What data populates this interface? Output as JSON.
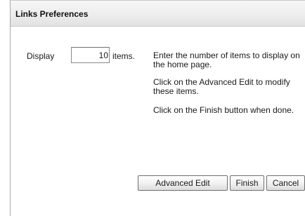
{
  "panel": {
    "title": "Links Preferences"
  },
  "form": {
    "display_label": "Display",
    "count_value": "10",
    "items_label": "items."
  },
  "instructions": [
    "Enter the number of items to display on the home page.",
    "Click on the Advanced Edit to modify these items.",
    "Click on the Finish button when done."
  ],
  "buttons": {
    "advanced_edit": "Advanced Edit",
    "finish": "Finish",
    "cancel": "Cancel"
  }
}
